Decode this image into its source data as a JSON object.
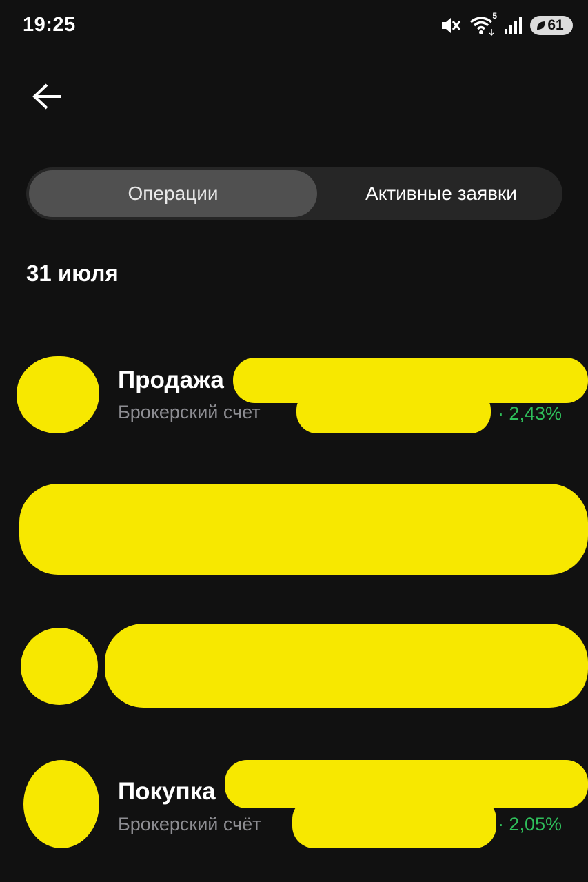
{
  "status_bar": {
    "time": "19:25",
    "wifi_badge": "5",
    "battery_level": "61",
    "icons": [
      "mute-vibrate-icon",
      "wifi-icon",
      "signal-icon",
      "battery-icon"
    ]
  },
  "header": {
    "back_icon": "arrow-left-icon"
  },
  "tabs": [
    {
      "label": "Операции",
      "active": true
    },
    {
      "label": "Активные заявки",
      "active": false
    }
  ],
  "date_group": {
    "label": "31 июля"
  },
  "operations": [
    {
      "title": "Продажа",
      "subtitle": "Брокерский счет",
      "percent": "· 2,43%"
    },
    {
      "title": "Покупка",
      "subtitle": "Брокерский счёт",
      "percent": "· 2,05%"
    }
  ],
  "colors": {
    "background": "#111111",
    "accent_positive": "#2fbf5b",
    "redaction": "#f7e800",
    "segment_active": "#505050",
    "segment_track": "#262626",
    "secondary_text": "#8e8e93"
  }
}
